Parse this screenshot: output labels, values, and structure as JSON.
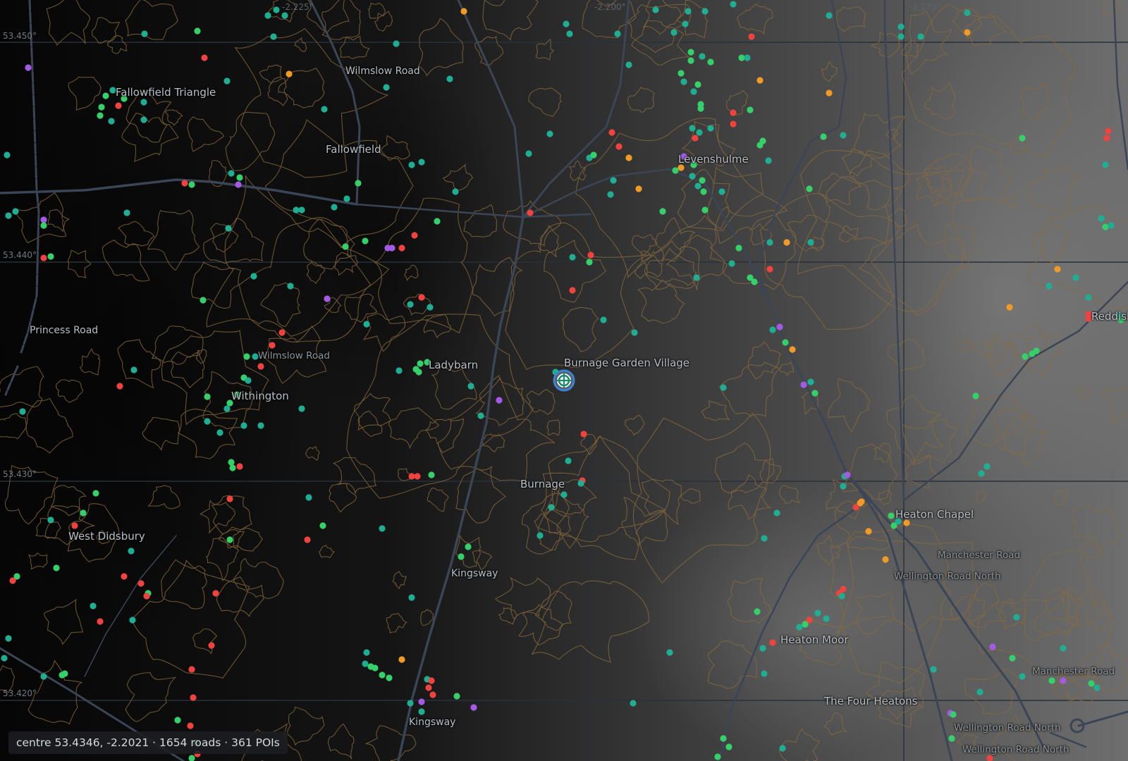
{
  "status": {
    "text": "centre 53.4346, -2.2021 · 1654 roads · 361 POIs"
  },
  "grid_labels": {
    "lat": [
      "53.450°",
      "53.440°",
      "53.430°",
      "53.420°"
    ],
    "lon": [
      "-2.225°",
      "-2.200°",
      "-2.175°"
    ]
  },
  "places": {
    "fallowfield_triangle": "Fallowfield Triangle",
    "wilmslow_road_n": "Wilmslow Road",
    "fallowfield": "Fallowfield",
    "levenshulme": "Levenshulme",
    "princess_road": "Princess Road",
    "wilmslow_road_s": "Wilmslow Road",
    "withington": "Withington",
    "ladybarn": "Ladybarn",
    "burnage_garden_village": "Burnage Garden Village",
    "burnage": "Burnage",
    "west_didsbury": "West Didsbury",
    "kingsway_1": "Kingsway",
    "kingsway_2": "Kingsway",
    "heaton_chapel": "Heaton Chapel",
    "manchester_road_1": "Manchester Road",
    "wellington_road_north_1": "Wellington Road North",
    "heaton_moor": "Heaton Moor",
    "the_four_heatons": "The Four Heatons",
    "manchester_road_2": "Manchester Road",
    "wellington_road_north_2": "Wellington Road North",
    "wellington_road_north_3": "Wellington Road North",
    "reddish": "Reddish"
  },
  "poi_colors": {
    "teal": "#1fae92",
    "green": "#36d06a",
    "red": "#f0433f",
    "orange": "#f29a26",
    "purple": "#a35be6"
  },
  "colors": {
    "road": "#3a4556",
    "contour": "#8a6b3d",
    "grid": "#28303b",
    "marker_ring": "#3b83d6"
  },
  "icons": {
    "location_marker": "crosshair-target-icon"
  }
}
